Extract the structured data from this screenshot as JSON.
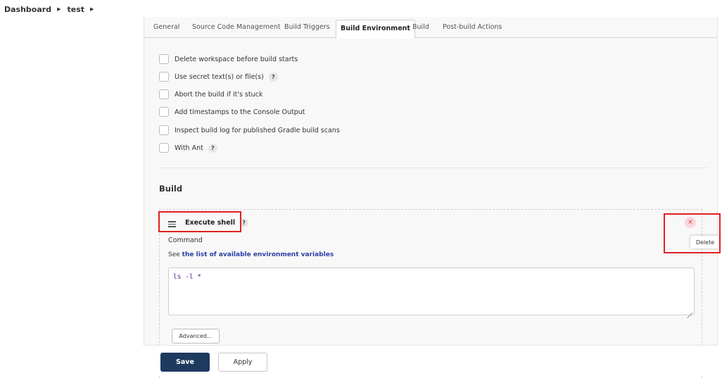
{
  "breadcrumb": {
    "items": [
      "Dashboard",
      "test"
    ]
  },
  "tabs": [
    {
      "label": "General"
    },
    {
      "label": "Source Code Management"
    },
    {
      "label": "Build Triggers"
    },
    {
      "label": "Build Environment",
      "active": true
    },
    {
      "label": "Build"
    },
    {
      "label": "Post-build Actions"
    }
  ],
  "build_environment": {
    "options": [
      {
        "label": "Delete workspace before build starts",
        "checked": false
      },
      {
        "label": "Use secret text(s) or file(s)",
        "checked": false,
        "help": "?"
      },
      {
        "label": "Abort the build if it's stuck",
        "checked": false
      },
      {
        "label": "Add timestamps to the Console Output",
        "checked": false
      },
      {
        "label": "Inspect build log for published Gradle build scans",
        "checked": false
      },
      {
        "label": "With Ant",
        "checked": false,
        "help": "?"
      }
    ]
  },
  "build": {
    "title": "Build",
    "step": {
      "title": "Execute shell",
      "help": "?",
      "command_label": "Command",
      "env_prefix": "See",
      "env_link": "the list of available environment variables",
      "command_value": "ls -l *",
      "advanced_label": "Advanced...",
      "delete_icon": "×",
      "delete_tooltip": "Delete"
    }
  },
  "actions": {
    "save_label": "Save",
    "apply_label": "Apply"
  },
  "colors": {
    "save_bg": "#1d3a5f",
    "link": "#2a3fa8",
    "highlight": "#e02020",
    "delete_bg": "#f8d7dc"
  }
}
